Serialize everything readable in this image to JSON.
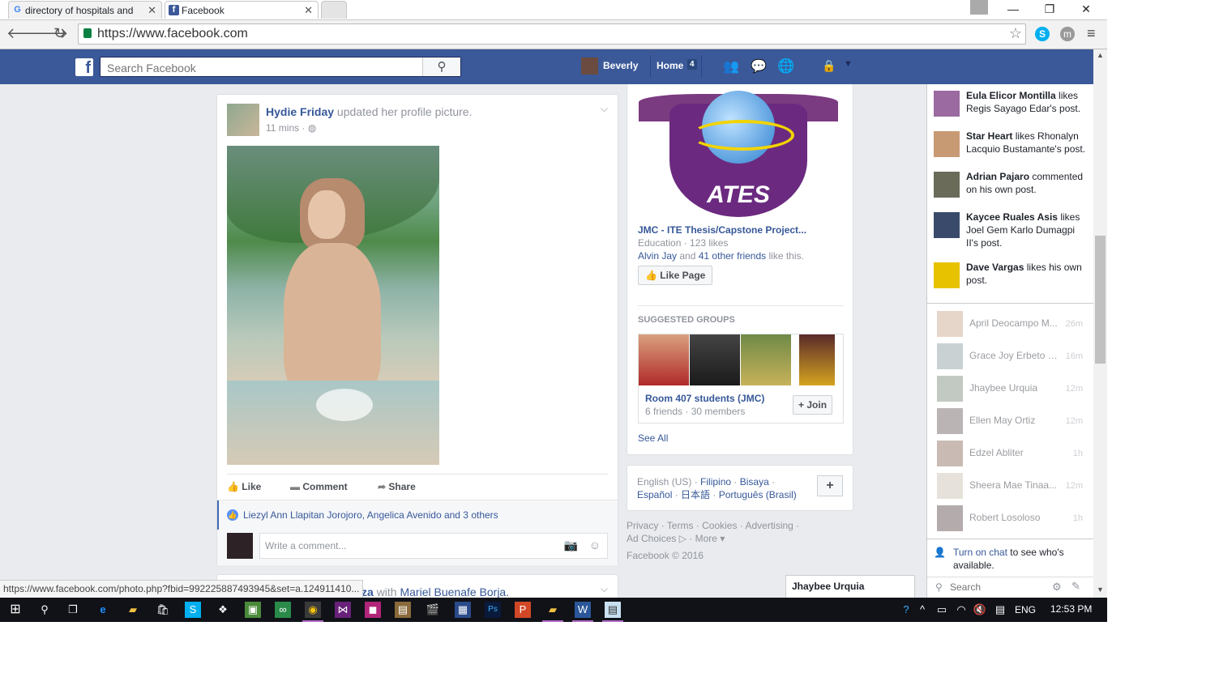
{
  "browser": {
    "tabs": [
      {
        "label": "directory of hospitals and",
        "icon": "google-icon"
      },
      {
        "label": "Facebook",
        "icon": "facebook-icon"
      }
    ],
    "url": "https://www.facebook.com"
  },
  "fb_header": {
    "search_placeholder": "Search Facebook",
    "user_name": "Beverly",
    "home_label": "Home",
    "home_count": "4"
  },
  "post": {
    "author": "Hydie Friday",
    "action": "updated her profile picture.",
    "time": "11 mins",
    "like_label": "Like",
    "comment_label": "Comment",
    "share_label": "Share",
    "likers": "Liezyl Ann Llapitan Jorojoro, Angelica Avenido and 3 others",
    "comment_placeholder": "Write a comment..."
  },
  "next_post": {
    "partial_author": "za",
    "with_text": "with",
    "tagged": "Mariel Buenafe Borja."
  },
  "status_url": "https://www.facebook.com/photo.php?fbid=992225887493945&set=a.124911410...",
  "page_suggestion": {
    "name": "JMC - ITE Thesis/Capstone Project...",
    "meta": "Education · 123 likes",
    "friend": "Alvin Jay",
    "and_text": "and",
    "others": "41 other friends",
    "like_this": "like this.",
    "like_button": "Like Page",
    "logo_text": "ATES"
  },
  "suggested_groups": {
    "heading": "SUGGESTED GROUPS",
    "group_name": "Room 407 students (JMC)",
    "group_meta": "6 friends · 30 members",
    "join_label": "Join",
    "see_all": "See All"
  },
  "languages": {
    "current": "English (US)",
    "options": [
      "Filipino",
      "Bisaya",
      "Español",
      "日本語",
      "Português (Brasil)"
    ]
  },
  "footer": {
    "links": "Privacy · Terms · Cookies · Advertising ·",
    "ad_choices": "Ad Choices",
    "more": "More",
    "copyright": "Facebook © 2016"
  },
  "ticker": [
    {
      "name": "Eula Elicor Montilla",
      "rest": "likes Regis Sayago Edar's post."
    },
    {
      "name": "Star Heart",
      "rest": "likes Rhonalyn Lacquio Bustamante's post."
    },
    {
      "name": "Adrian Pajaro",
      "rest": "commented on his own post."
    },
    {
      "name": "Kaycee Ruales Asis",
      "rest": "likes Joel Gem Karlo Dumagpi II's post."
    },
    {
      "name": "Dave Vargas",
      "rest": "likes his own post."
    }
  ],
  "chat": [
    {
      "name": "April Deocampo M...",
      "time": "26m"
    },
    {
      "name": "Grace Joy Erbeto S...",
      "time": "16m"
    },
    {
      "name": "Jhaybee Urquia",
      "time": "12m"
    },
    {
      "name": "Ellen May Ortiz",
      "time": "12m"
    },
    {
      "name": "Edzel Abliter",
      "time": "1h"
    },
    {
      "name": "Sheera Mae Tinaa...",
      "time": "12m"
    },
    {
      "name": "Robert Losoloso",
      "time": "1h"
    }
  ],
  "chat_footer": {
    "turn_on": "Turn on chat",
    "rest": "to see who's available.",
    "search_placeholder": "Search"
  },
  "chat_tab": "Jhaybee Urquia",
  "taskbar": {
    "time": "12:53 PM",
    "lang": "ENG"
  },
  "colors": {
    "fb_blue": "#3b5998",
    "link": "#365899",
    "background": "#e9ebee"
  }
}
